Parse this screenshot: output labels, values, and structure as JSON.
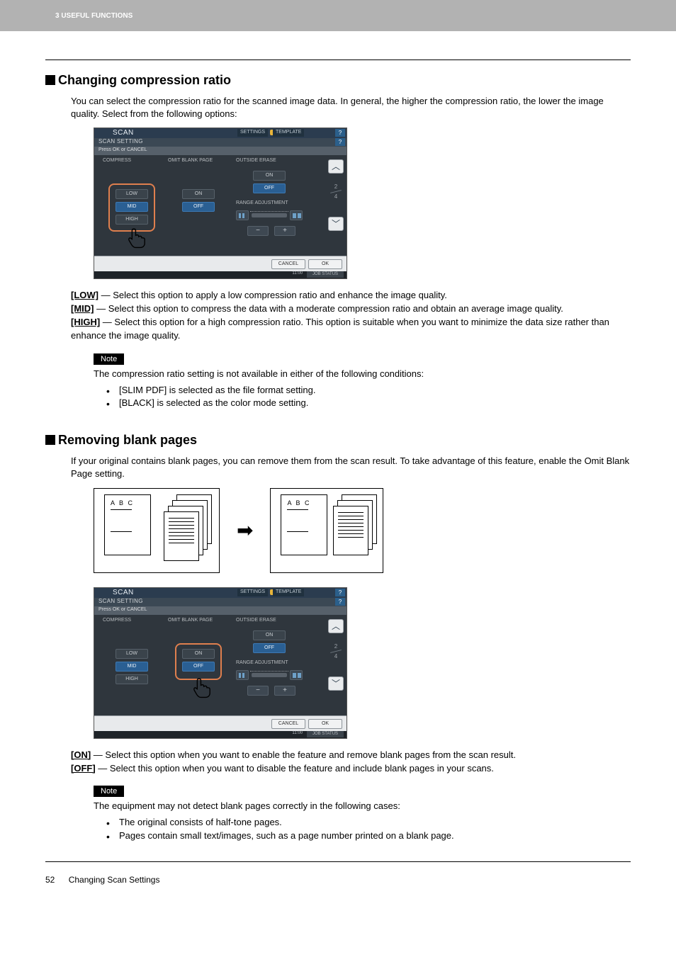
{
  "header": {
    "chapter": "3 USEFUL FUNCTIONS"
  },
  "section1": {
    "title": "Changing compression ratio",
    "intro": "You can select the compression ratio for the scanned image data. In general, the higher the compression ratio, the lower the image quality. Select from the following options:",
    "defs": {
      "low_k": "[LOW]",
      "low_v": " — Select this option to apply a low compression ratio and enhance the image quality.",
      "mid_k": "[MID]",
      "mid_v": " — Select this option to compress the data with a moderate compression ratio and obtain an average image quality.",
      "high_k": "[HIGH]",
      "high_v": " — Select this option for a high compression ratio. This option is suitable when you want to minimize the data size rather than enhance the image quality."
    },
    "note_label": "Note",
    "note_intro": "The compression ratio setting is not available in either of the following conditions:",
    "note_b1": "[SLIM PDF] is selected as the file format setting.",
    "note_b2": "[BLACK] is selected as the color mode setting."
  },
  "section2": {
    "title": "Removing blank pages",
    "intro": "If your original contains blank pages, you can remove them from the scan result. To take advantage of this feature, enable the Omit Blank Page setting.",
    "diagram_abc": "A B C",
    "defs": {
      "on_k": "[ON]",
      "on_v": " — Select this option when you want to enable the feature and remove blank pages from the scan result.",
      "off_k": "[OFF]",
      "off_v": " — Select this option when you want to disable the feature and include blank pages in your scans."
    },
    "note_label": "Note",
    "note_intro": "The equipment may not detect blank pages correctly in the following cases:",
    "note_b1": "The original consists of half-tone pages.",
    "note_b2": "Pages contain small text/images, such as a page number printed on a blank page."
  },
  "panel": {
    "scan": "SCAN",
    "settings": "SETTINGS",
    "template": "TEMPLATE",
    "sub": "SCAN SETTING",
    "instr": "Press OK or CANCEL",
    "compress": "COMPRESS",
    "omit": "OMIT BLANK PAGE",
    "outside": "OUTSIDE ERASE",
    "low": "LOW",
    "mid": "MID",
    "high": "HIGH",
    "on": "ON",
    "off": "OFF",
    "range": "RANGE ADJUSTMENT",
    "minus": "−",
    "plus": "+",
    "pg_top": "2",
    "pg_bot": "4",
    "cancel": "CANCEL",
    "ok": "OK",
    "time": "11:00",
    "job": "JOB STATUS",
    "help": "?"
  },
  "footer": {
    "page": "52",
    "title": "Changing Scan Settings"
  }
}
